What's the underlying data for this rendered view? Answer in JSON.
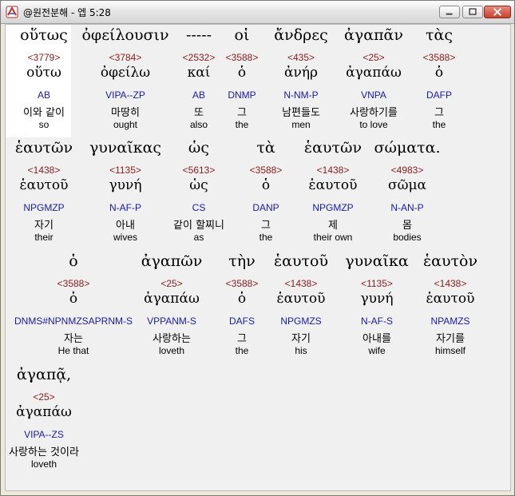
{
  "window": {
    "title": "@원전분해 - 엡 5:28",
    "controls": {
      "minimize": "minimize",
      "maximize": "maximize",
      "close": "close"
    }
  },
  "words": [
    {
      "greek": "οὕτως",
      "strong": "<3779>",
      "lemma": "οὕτω",
      "parse": "AB",
      "korean": "이와 같이",
      "english": "so"
    },
    {
      "greek": "ὀφείλουσιν",
      "strong": "<3784>",
      "lemma": "ὀφείλω",
      "parse": "VIPA--ZP",
      "korean": "마땅히",
      "english": "ought"
    },
    {
      "greek": "-----",
      "strong": "<2532>",
      "lemma": "καί",
      "parse": "AB",
      "korean": "또",
      "english": "also"
    },
    {
      "greek": "οἱ",
      "strong": "<3588>",
      "lemma": "ὁ",
      "parse": "DNMP",
      "korean": "그",
      "english": "the"
    },
    {
      "greek": "ἄνδρες",
      "strong": "<435>",
      "lemma": "ἀνήρ",
      "parse": "N-NM-P",
      "korean": "남편들도",
      "english": "men"
    },
    {
      "greek": "ἀγαπᾶν",
      "strong": "<25>",
      "lemma": "ἀγαπάω",
      "parse": "VNPA",
      "korean": "사랑하기를",
      "english": "to love"
    },
    {
      "greek": "τὰς",
      "strong": "<3588>",
      "lemma": "ὁ",
      "parse": "DAFP",
      "korean": "그",
      "english": "the"
    },
    {
      "greek": "ἑαυτῶν",
      "strong": "<1438>",
      "lemma": "ἑαυτοῦ",
      "parse": "NPGMZP",
      "korean": "자기",
      "english": "their"
    },
    {
      "greek": "γυναῖκας",
      "strong": "<1135>",
      "lemma": "γυνή",
      "parse": "N-AF-P",
      "korean": "아내",
      "english": "wives"
    },
    {
      "greek": "ὡς",
      "strong": "<5613>",
      "lemma": "ὡς",
      "parse": "CS",
      "korean": "같이 할찌니",
      "english": "as"
    },
    {
      "greek": "τὰ",
      "strong": "<3588>",
      "lemma": "ὁ",
      "parse": "DANP",
      "korean": "그",
      "english": "the"
    },
    {
      "greek": "ἑαυτῶν",
      "strong": "<1438>",
      "lemma": "ἑαυτοῦ",
      "parse": "NPGMZP",
      "korean": "제",
      "english": "their own"
    },
    {
      "greek": "σώματα.",
      "strong": "<4983>",
      "lemma": "σῶμα",
      "parse": "N-AN-P",
      "korean": "몸",
      "english": "bodies"
    },
    {
      "greek": "ὁ",
      "strong": "<3588>",
      "lemma": "ὁ",
      "parse": "DNMS#NPNMZSAPRNM-S",
      "korean": "자는",
      "english": "He that"
    },
    {
      "greek": "ἀγαπῶν",
      "strong": "<25>",
      "lemma": "ἀγαπάω",
      "parse": "VPPANM-S",
      "korean": "사랑하는",
      "english": "loveth"
    },
    {
      "greek": "τὴν",
      "strong": "<3588>",
      "lemma": "ὁ",
      "parse": "DAFS",
      "korean": "그",
      "english": "the"
    },
    {
      "greek": "ἑαυτοῦ",
      "strong": "<1438>",
      "lemma": "ἑαυτοῦ",
      "parse": "NPGMZS",
      "korean": "자기",
      "english": "his"
    },
    {
      "greek": "γυναῖκα",
      "strong": "<1135>",
      "lemma": "γυνή",
      "parse": "N-AF-S",
      "korean": "아내를",
      "english": "wife"
    },
    {
      "greek": "ἑαυτὸν",
      "strong": "<1438>",
      "lemma": "ἑαυτοῦ",
      "parse": "NPAMZS",
      "korean": "자기를",
      "english": "himself"
    },
    {
      "greek": "ἀγαπᾷ,",
      "strong": "<25>",
      "lemma": "ἀγαπάω",
      "parse": "VIPA--ZS",
      "korean": "사랑하는 것이라",
      "english": "loveth"
    }
  ]
}
